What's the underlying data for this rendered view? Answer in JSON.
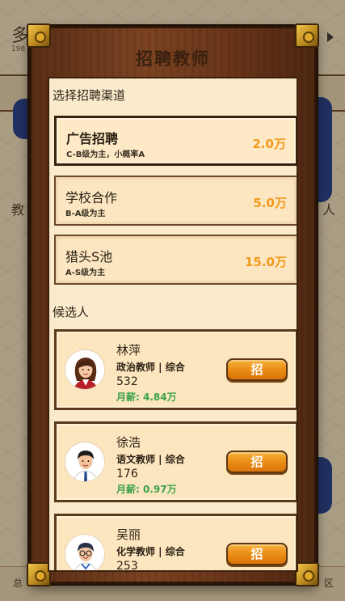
{
  "background": {
    "title": "多",
    "subtitle": "198",
    "left_tab": "教",
    "right_tab": "人",
    "bottom_left": "总",
    "bottom_right": "区"
  },
  "modal": {
    "title": "招聘教师",
    "channels_label": "选择招聘渠道",
    "candidates_label": "候选人",
    "channels": [
      {
        "name": "广告招聘",
        "desc": "C-B级为主，小概率A",
        "cost": "2.0万",
        "selected": true
      },
      {
        "name": "学校合作",
        "desc": "B-A级为主",
        "cost": "5.0万",
        "selected": false
      },
      {
        "name": "猎头S池",
        "desc": "A-S级为主",
        "cost": "15.0万",
        "selected": false
      }
    ],
    "candidates": [
      {
        "name": "林萍",
        "role": "政治教师 | 综合",
        "score": "532",
        "salary": "月薪: 4.84万",
        "hire_label": "招",
        "avatar": "female-teacher-avatar"
      },
      {
        "name": "徐浩",
        "role": "语文教师 | 综合",
        "score": "176",
        "salary": "月薪: 0.97万",
        "hire_label": "招",
        "avatar": "male-teacher-avatar"
      },
      {
        "name": "吴丽",
        "role": "化学教师 | 综合",
        "score": "253",
        "salary": "",
        "hire_label": "招",
        "avatar": "male-teacher-glasses-avatar"
      }
    ]
  },
  "colors": {
    "cost": "#f29a1b",
    "salary": "#3aa14a",
    "button": "#e98a12",
    "frame_wood": "#6a3519",
    "panel_bg": "#fbeacc"
  }
}
